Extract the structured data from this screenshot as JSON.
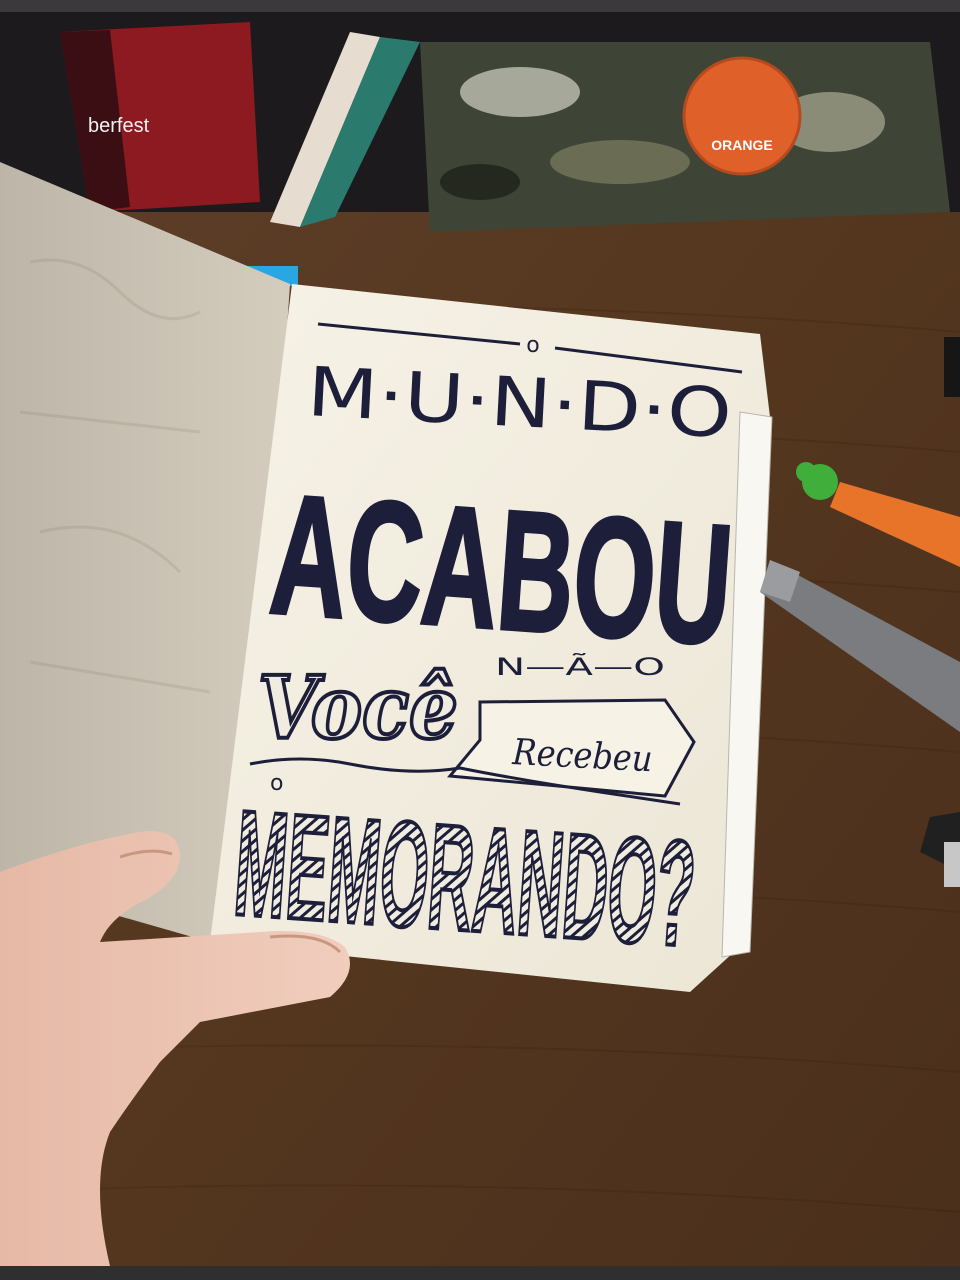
{
  "photo": {
    "subject": "hand-lettered notebook page",
    "page_text": {
      "line1": "M·U·N·D·O",
      "line1_accent": "o",
      "line2": "ACABOU",
      "line3_left": "Você",
      "line3_right_top": "N—Ã—O",
      "line3_right_banner": "Recebeu",
      "line3_small_o": "o",
      "line4": "MEMORANDO?"
    },
    "background_items": {
      "badge_text": "ORANGE",
      "sticker_text": "berfest"
    },
    "colors": {
      "table": "#5a3a25",
      "paper": "#f1ece0",
      "left_page": "#c9c2b4",
      "ink": "#1d1f3a",
      "marker_orange": "#e8742a",
      "marker_green": "#3fae3a",
      "pen_gray": "#7a7c80",
      "badge_orange": "#e0602a"
    }
  }
}
